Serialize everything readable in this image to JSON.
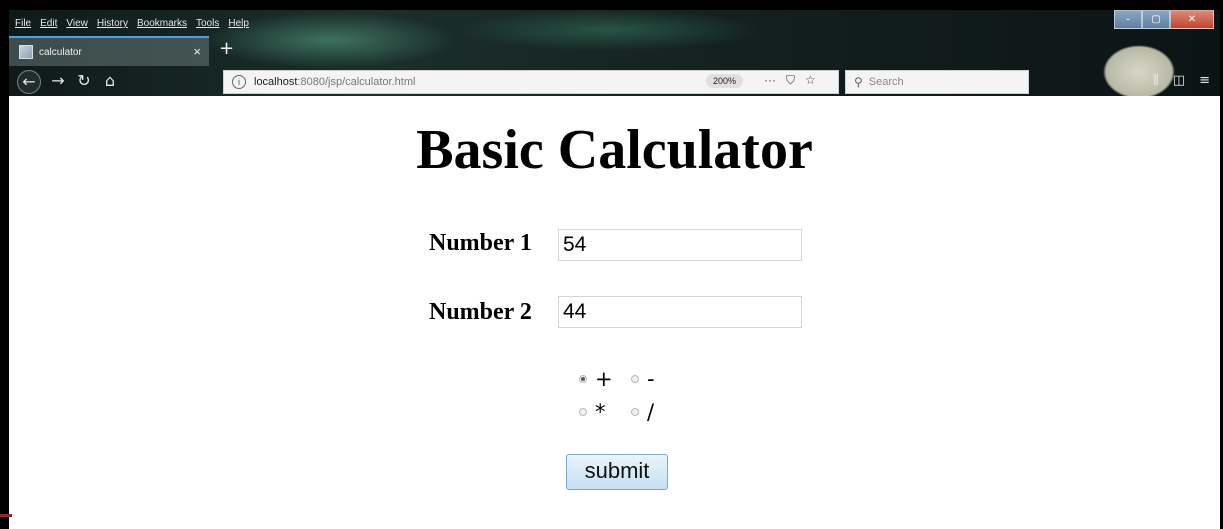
{
  "menu": [
    "File",
    "Edit",
    "View",
    "History",
    "Bookmarks",
    "Tools",
    "Help"
  ],
  "tab": {
    "title": "calculator",
    "close": "×",
    "new_tab": "+"
  },
  "nav": {
    "back": "←",
    "forward": "→",
    "reload": "↻",
    "home": "⌂"
  },
  "url": {
    "host": "localhost",
    "rest": ":8080/jsp/calculator.html",
    "zoom": "200%"
  },
  "url_actions": {
    "more": "···",
    "pocket": "⛉",
    "bookmark": "☆"
  },
  "search": {
    "placeholder": "Search"
  },
  "window": {
    "minimize": "–",
    "maximize": "▢",
    "close": "✕"
  },
  "page": {
    "title": "Basic Calculator",
    "number1_label": "Number 1",
    "number1_value": "54",
    "number2_label": "Number 2",
    "number2_value": "44",
    "operations": [
      {
        "label": "+",
        "checked": true
      },
      {
        "label": "-",
        "checked": false
      },
      {
        "label": "*",
        "checked": false
      },
      {
        "label": "/",
        "checked": false
      }
    ],
    "submit_label": "submit"
  },
  "colors": {
    "accent": "#4aa3df",
    "submit_border": "#7aa9d4",
    "close_red": "#c0452e"
  }
}
